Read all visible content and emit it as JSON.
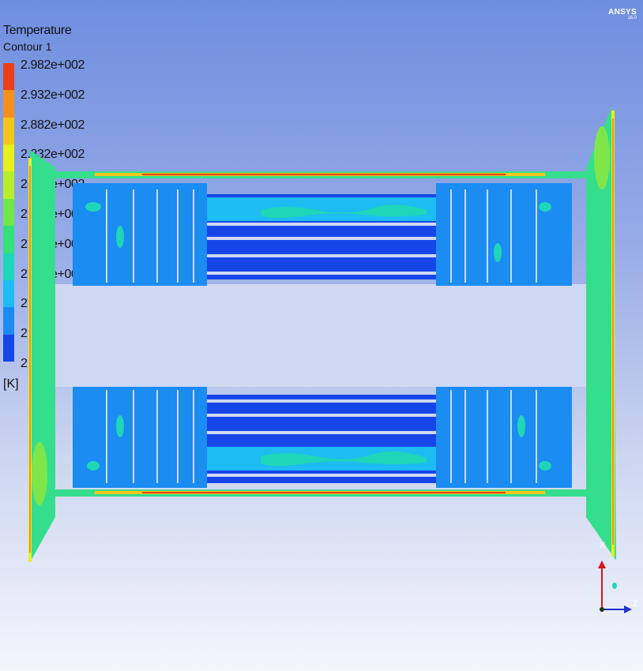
{
  "brand": {
    "name": "ANSYS",
    "version": "16.0"
  },
  "legend": {
    "title": "Temperature",
    "subtitle": "Contour 1",
    "unit": "[K]",
    "labels": [
      "2.982e+002",
      "2.932e+002",
      "2.882e+002",
      "2.832e+002",
      "2.782e+002",
      "2.732e+002",
      "2.682e+002",
      "2.632e+002",
      "2.581e+002",
      "2.531e+002",
      "2.481e+002"
    ],
    "colors": [
      "#e8401c",
      "#f3901c",
      "#f4c51c",
      "#e8f01c",
      "#b6ee2c",
      "#6fe64a",
      "#33e07a",
      "#1fd6b8",
      "#1dbcf2",
      "#1a8cf2",
      "#1746e8"
    ]
  },
  "axes": {
    "vertical": "X",
    "horizontal": "Z",
    "depth_marker_color": "#1fd6b8"
  }
}
